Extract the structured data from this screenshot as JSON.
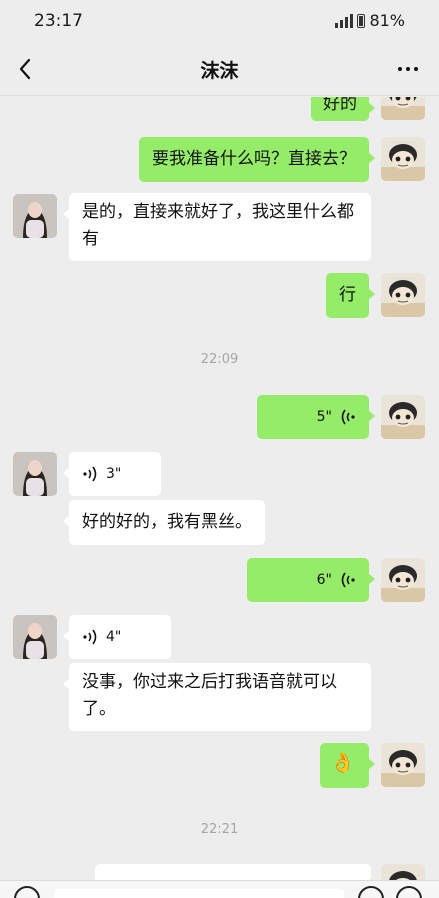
{
  "status_bar": {
    "time": "23:17",
    "battery": "81%"
  },
  "header": {
    "title": "沫沫"
  },
  "messages": [
    {
      "text": "好的"
    },
    {
      "text": "要我准备什么吗？直接去？"
    },
    {
      "text": "是的，直接来就好了，我这里什么都有"
    },
    {
      "text": "行"
    },
    {
      "timestamp": "22:09"
    },
    {
      "duration": "5\""
    },
    {
      "duration": "3\""
    },
    {
      "text": "好的好的，我有黑丝。"
    },
    {
      "duration": "6\""
    },
    {
      "duration": "4\""
    },
    {
      "text": "没事，你过来之后打我语音就可以了。"
    },
    {
      "emoji": "👌"
    },
    {
      "timestamp": "22:21"
    }
  ],
  "colors": {
    "outgoing_bubble": "#95ec69",
    "incoming_bubble": "#ffffff",
    "background": "#ededed"
  },
  "icons": [
    "back-icon",
    "more-icon",
    "signal-icon",
    "battery-icon",
    "voice-wave-icon",
    "avatar-self",
    "avatar-contact"
  ]
}
